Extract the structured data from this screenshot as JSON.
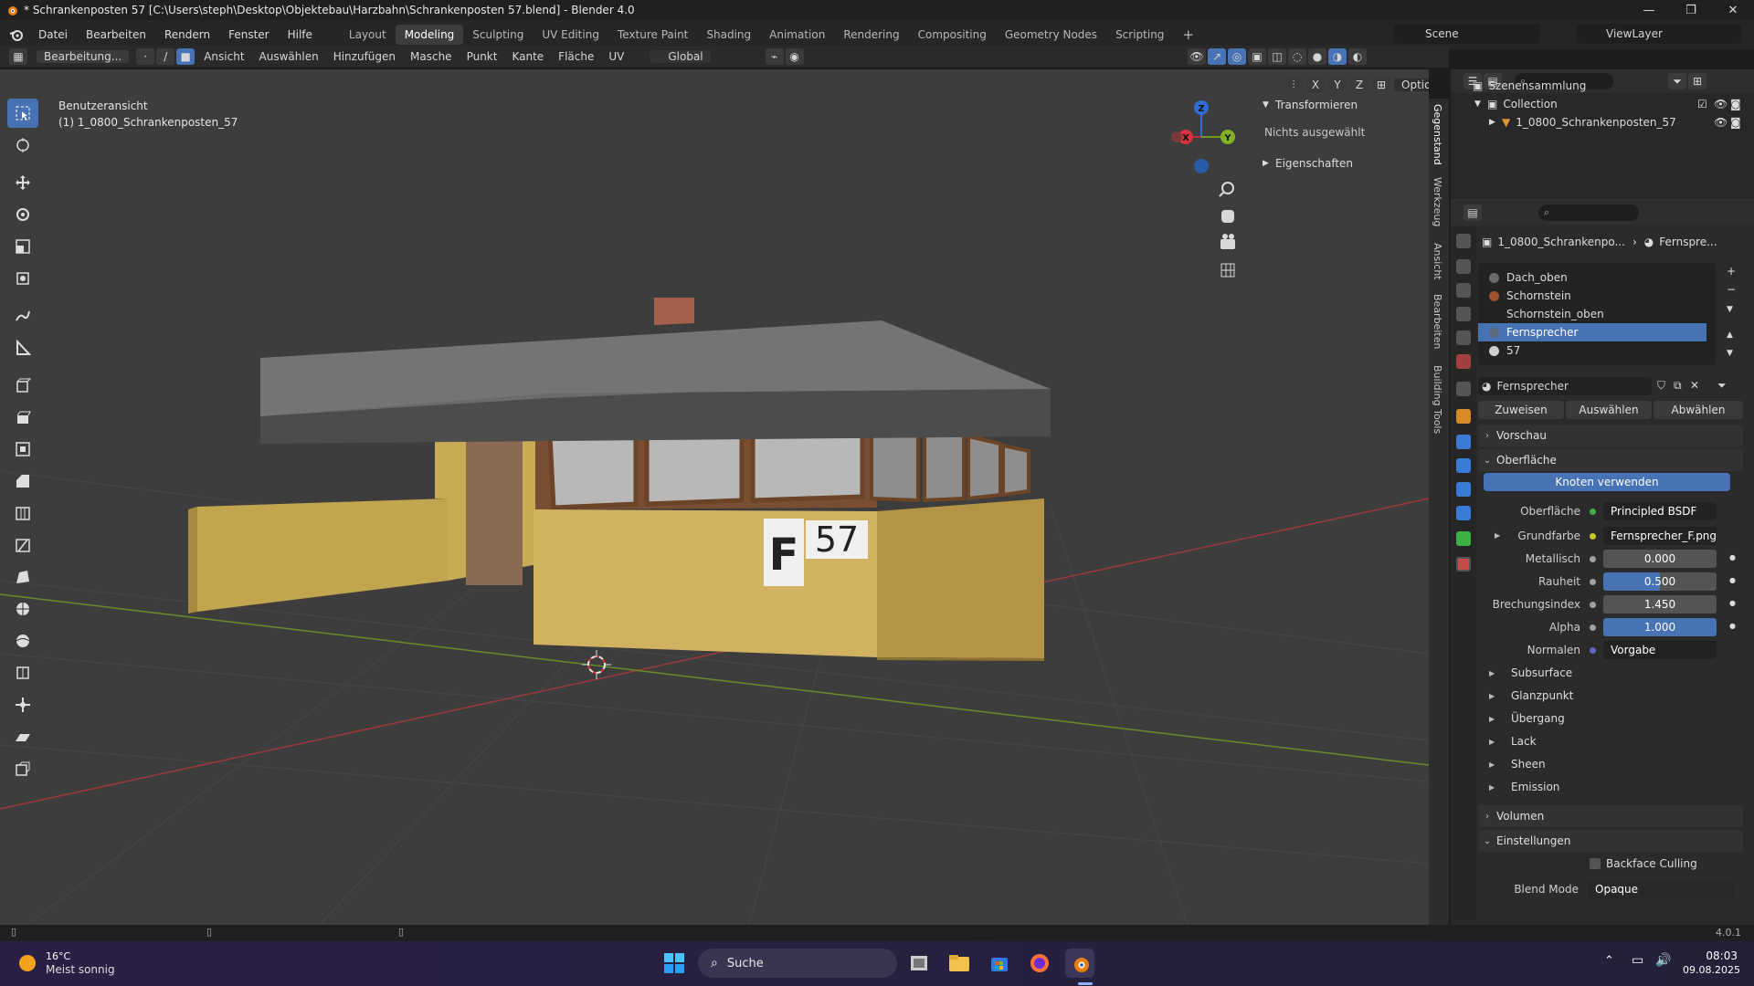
{
  "window": {
    "title": "* Schrankenposten 57 [C:\\Users\\steph\\Desktop\\Objektebau\\Harzbahn\\Schrankenposten 57.blend] - Blender 4.0"
  },
  "menu": [
    "Datei",
    "Bearbeiten",
    "Rendern",
    "Fenster",
    "Hilfe"
  ],
  "workspaces": [
    "Layout",
    "Modeling",
    "Sculpting",
    "UV Editing",
    "Texture Paint",
    "Shading",
    "Animation",
    "Rendering",
    "Compositing",
    "Geometry Nodes",
    "Scripting"
  ],
  "active_workspace": "Modeling",
  "scene": {
    "label": "Scene",
    "viewlayer": "ViewLayer"
  },
  "header": {
    "mode": "Bearbeitung...",
    "items": [
      "Ansicht",
      "Auswählen",
      "Hinzufügen",
      "Masche",
      "Punkt",
      "Kante",
      "Fläche",
      "UV"
    ],
    "orientation": "Global",
    "options": "Optionen",
    "axes": [
      "X",
      "Y",
      "Z"
    ]
  },
  "viewport": {
    "view_name": "Benutzeransicht",
    "object_name": "(1) 1_0800_Schrankenposten_57",
    "sign_letter": "F",
    "sign_number": "57",
    "gizmo_labels": [
      "Z",
      "Y",
      "X"
    ]
  },
  "npanel": {
    "transform": "Transformieren",
    "nothing_selected": "Nichts ausgewählt",
    "properties": "Eigenschaften",
    "tabs": [
      "Gegenstand",
      "Werkzeug",
      "Ansicht",
      "Bearbeiten",
      "Building Tools"
    ]
  },
  "outliner": {
    "root": "Szenensammlung",
    "collection": "Collection",
    "object": "1_0800_Schrankenposten_57"
  },
  "properties": {
    "breadcrumb_object": "1_0800_Schrankenpo...",
    "breadcrumb_material": "Fernspre...",
    "slots": [
      {
        "name": "Dach_oben",
        "color": "#6a6a6a"
      },
      {
        "name": "Schornstein",
        "color": "#a0522d"
      },
      {
        "name": "Schornstein_oben",
        "color": "#222222"
      },
      {
        "name": "Fernsprecher",
        "color": "#5a6a7a"
      },
      {
        "name": "57",
        "color": "#cfcfcf"
      }
    ],
    "selected_slot": "Fernsprecher",
    "material_name": "Fernsprecher",
    "assign": "Zuweisen",
    "select": "Auswählen",
    "deselect": "Abwählen",
    "preview": "Vorschau",
    "surface_section": "Oberfläche",
    "use_nodes": "Knoten verwenden",
    "surface_label": "Oberfläche",
    "surface_value": "Principled BSDF",
    "fields": [
      {
        "label": "Grundfarbe",
        "value": "Fernsprecher_F.png",
        "socket": "#c7c729",
        "kind": "dark"
      },
      {
        "label": "Metallisch",
        "value": "0.000",
        "socket": "#a1a1a1",
        "kind": "slider",
        "fill": 0.0
      },
      {
        "label": "Rauheit",
        "value": "0.500",
        "socket": "#a1a1a1",
        "kind": "slider",
        "fill": 0.5
      },
      {
        "label": "Brechungsindex",
        "value": "1.450",
        "socket": "#a1a1a1",
        "kind": "slider",
        "fill": 0.0
      },
      {
        "label": "Alpha",
        "value": "1.000",
        "socket": "#a1a1a1",
        "kind": "slider",
        "fill": 1.0
      },
      {
        "label": "Normalen",
        "value": "Vorgabe",
        "socket": "#6363c7",
        "kind": "dark"
      }
    ],
    "subpanels": [
      "Subsurface",
      "Glanzpunkt",
      "Übergang",
      "Lack",
      "Sheen",
      "Emission"
    ],
    "volume": "Volumen",
    "settings": "Einstellungen",
    "backface": "Backface Culling",
    "blend_mode_label": "Blend Mode",
    "blend_mode": "Opaque",
    "version": "4.0.1"
  },
  "taskbar": {
    "temp": "16°C",
    "weather": "Meist sonnig",
    "search": "Suche",
    "time": "08:03",
    "date": "09.08.2025"
  },
  "colors": {
    "accent": "#4772b3",
    "viewport_bg": "#3d3d3d",
    "grid_x": "#9b3a3a",
    "grid_y": "#6b8a2a"
  }
}
